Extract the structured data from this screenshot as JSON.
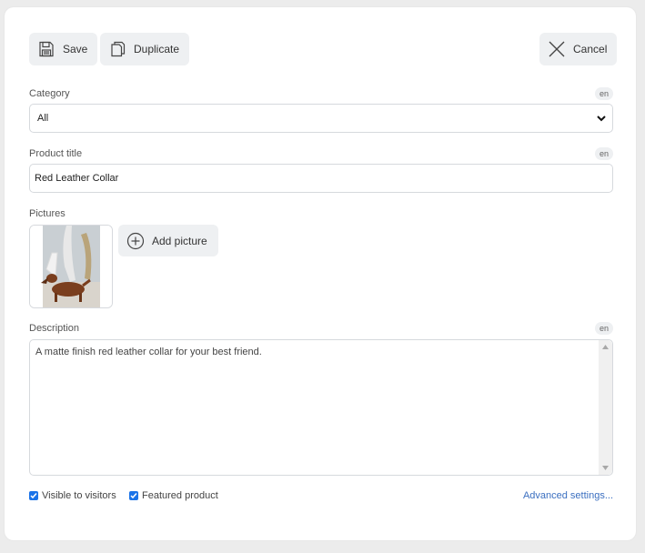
{
  "toolbar": {
    "save_label": "Save",
    "duplicate_label": "Duplicate",
    "cancel_label": "Cancel"
  },
  "form": {
    "category": {
      "label": "Category",
      "lang": "en",
      "value": "All"
    },
    "title": {
      "label": "Product title",
      "lang": "en",
      "value": "Red Leather Collar"
    },
    "pictures": {
      "label": "Pictures",
      "add_label": "Add picture"
    },
    "description": {
      "label": "Description",
      "lang": "en",
      "value": "A matte finish red leather collar for your best friend."
    },
    "visible": {
      "label": "Visible to visitors",
      "checked": true
    },
    "featured": {
      "label": "Featured product",
      "checked": true
    },
    "advanced_label": "Advanced settings..."
  },
  "icons": {
    "save": "floppy-disk-icon",
    "duplicate": "copy-icon",
    "cancel": "close-icon",
    "add": "plus-circle-icon"
  },
  "colors": {
    "accent": "#1a73e8",
    "link": "#3b6fc0",
    "button_bg": "#eef0f2"
  }
}
